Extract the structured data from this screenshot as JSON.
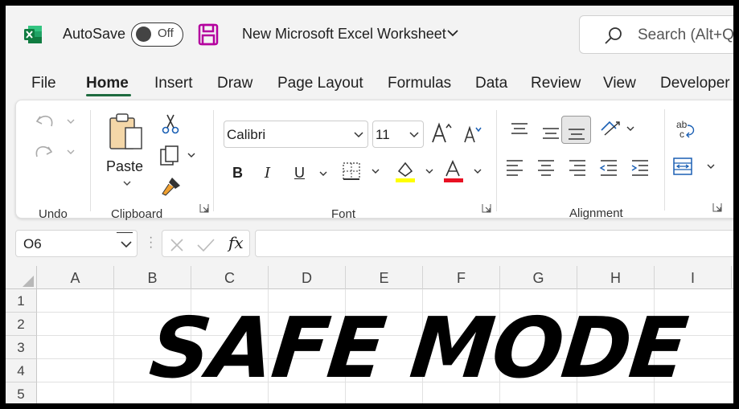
{
  "app": {
    "icon": "excel-logo-icon",
    "brand_color": "#1e6b3f"
  },
  "titlebar": {
    "autosave_label": "AutoSave",
    "autosave_state": "Off",
    "save_icon": "save-icon",
    "document_title": "New Microsoft Excel Worksheet",
    "search_placeholder": "Search (Alt+Q)"
  },
  "tabs": [
    {
      "label": "File"
    },
    {
      "label": "Home",
      "active": true
    },
    {
      "label": "Insert"
    },
    {
      "label": "Draw"
    },
    {
      "label": "Page Layout"
    },
    {
      "label": "Formulas"
    },
    {
      "label": "Data"
    },
    {
      "label": "Review"
    },
    {
      "label": "View"
    },
    {
      "label": "Developer"
    }
  ],
  "ribbon": {
    "undo": {
      "label": "Undo"
    },
    "clipboard": {
      "label": "Clipboard",
      "paste_label": "Paste"
    },
    "font": {
      "label": "Font",
      "font_name": "Calibri",
      "font_size": "11",
      "bold": "B",
      "italic": "I",
      "underline": "U",
      "highlight_color": "#ffff00",
      "font_color": "#e81123"
    },
    "alignment": {
      "label": "Alignment"
    }
  },
  "formula_bar": {
    "name_box": "O6",
    "fx": "fx",
    "formula": ""
  },
  "sheet": {
    "columns": [
      "A",
      "B",
      "C",
      "D",
      "E",
      "F",
      "G",
      "H",
      "I"
    ],
    "rows": [
      "1",
      "2",
      "3",
      "4",
      "5"
    ]
  },
  "overlay_text": "SAFE MODE"
}
